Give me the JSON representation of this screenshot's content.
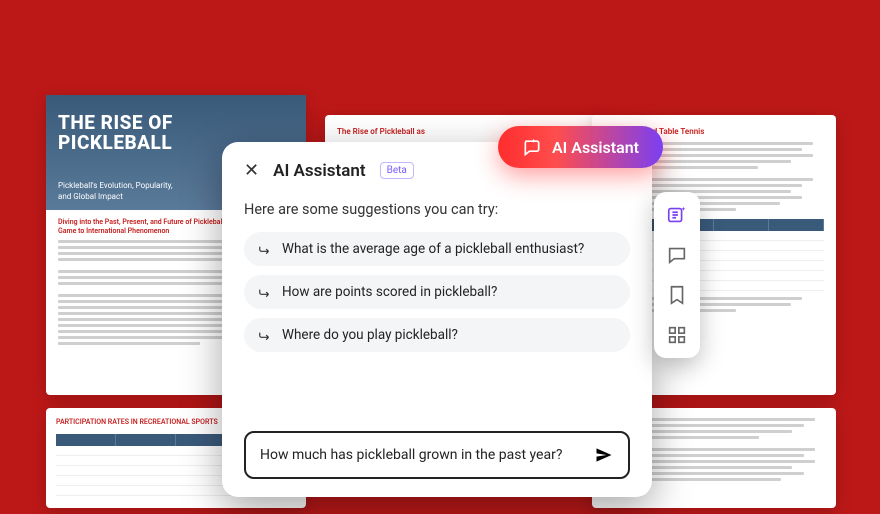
{
  "bg_docs": {
    "doc1": {
      "title_line1": "THE RISE OF",
      "title_line2": "PICKLEBALL",
      "subtitle": "Pickleball's Evolution, Popularity, and Global Impact",
      "section_heading": "Diving into the Past, Present, and Future of Pickleball: From Backyard Game to International Phenomenon"
    },
    "doc2": {
      "heading": "The Rise of Pickleball as"
    },
    "doc3": {
      "heading": "all, Tennis, and Table Tennis"
    },
    "doc4": {
      "heading": "PARTICIPATION RATES IN RECREATIONAL SPORTS"
    }
  },
  "ai_button": {
    "label": "AI Assistant"
  },
  "panel": {
    "title": "AI Assistant",
    "badge": "Beta",
    "intro": "Here are some suggestions you can try:",
    "suggestions": [
      "What is the average age of a pickleball enthusiast?",
      "How are points scored in pickleball?",
      "Where do you play pickleball?"
    ],
    "input_value": "How much has pickleball grown in the past year?"
  },
  "toolbar": {
    "items": [
      "summary",
      "chat",
      "bookmark",
      "apps"
    ]
  }
}
